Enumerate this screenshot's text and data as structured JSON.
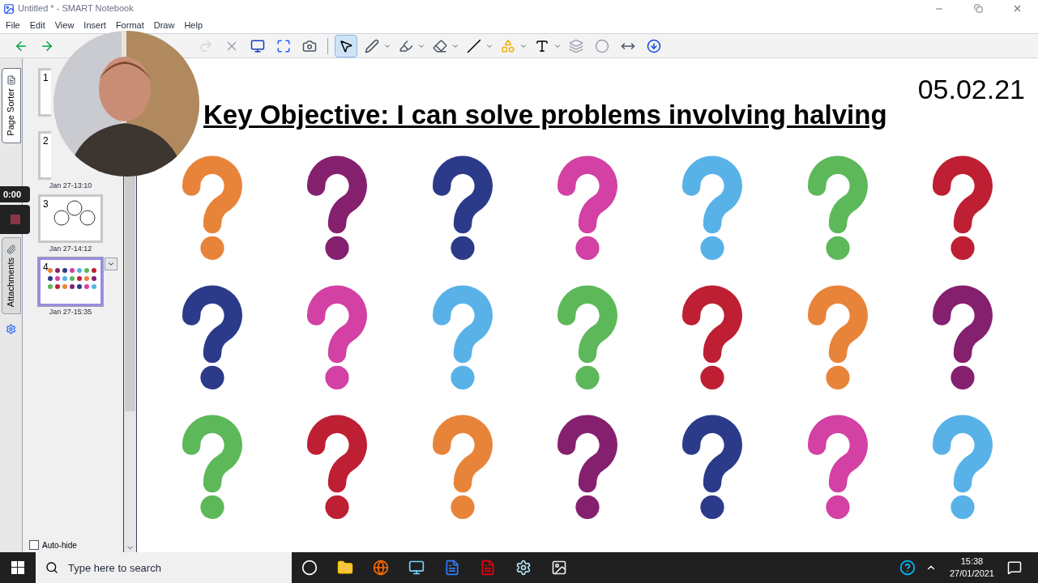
{
  "window": {
    "title": "Untitled * - SMART Notebook"
  },
  "menu": [
    "File",
    "Edit",
    "View",
    "Insert",
    "Format",
    "Draw",
    "Help"
  ],
  "sidebar": {
    "tabs": [
      {
        "label": "Page Sorter",
        "selected": true
      },
      {
        "label": "Attachments",
        "selected": false
      }
    ],
    "pages": [
      {
        "number": "1",
        "selected": false
      },
      {
        "number": "2",
        "date": "Jan 27-13:10",
        "selected": false
      },
      {
        "number": "3",
        "date": "Jan 27-14:12",
        "selected": false
      },
      {
        "number": "4",
        "date": "Jan 27-15:35",
        "selected": true
      }
    ],
    "auto_hide": {
      "label": "Auto-hide",
      "checked": false
    }
  },
  "recorder": {
    "time": "0:00"
  },
  "slide": {
    "date": "05.02.21",
    "title": "Key Objective: I can solve problems involving halving",
    "marks": [
      {
        "color": "#e8843a"
      },
      {
        "color": "#85206e"
      },
      {
        "color": "#2c3a8a"
      },
      {
        "color": "#d241a3"
      },
      {
        "color": "#58b2e8"
      },
      {
        "color": "#5db85a"
      },
      {
        "color": "#be1f33"
      },
      {
        "color": "#2c3a8a"
      },
      {
        "color": "#d241a3"
      },
      {
        "color": "#58b2e8"
      },
      {
        "color": "#5db85a"
      },
      {
        "color": "#be1f33"
      },
      {
        "color": "#e8843a"
      },
      {
        "color": "#85206e"
      },
      {
        "color": "#5db85a"
      },
      {
        "color": "#be1f33"
      },
      {
        "color": "#e8843a"
      },
      {
        "color": "#85206e"
      },
      {
        "color": "#2c3a8a"
      },
      {
        "color": "#d241a3"
      },
      {
        "color": "#58b2e8"
      }
    ]
  },
  "taskbar": {
    "search": {
      "placeholder": "Type here to search"
    },
    "time": "15:38",
    "date": "27/01/2021"
  }
}
